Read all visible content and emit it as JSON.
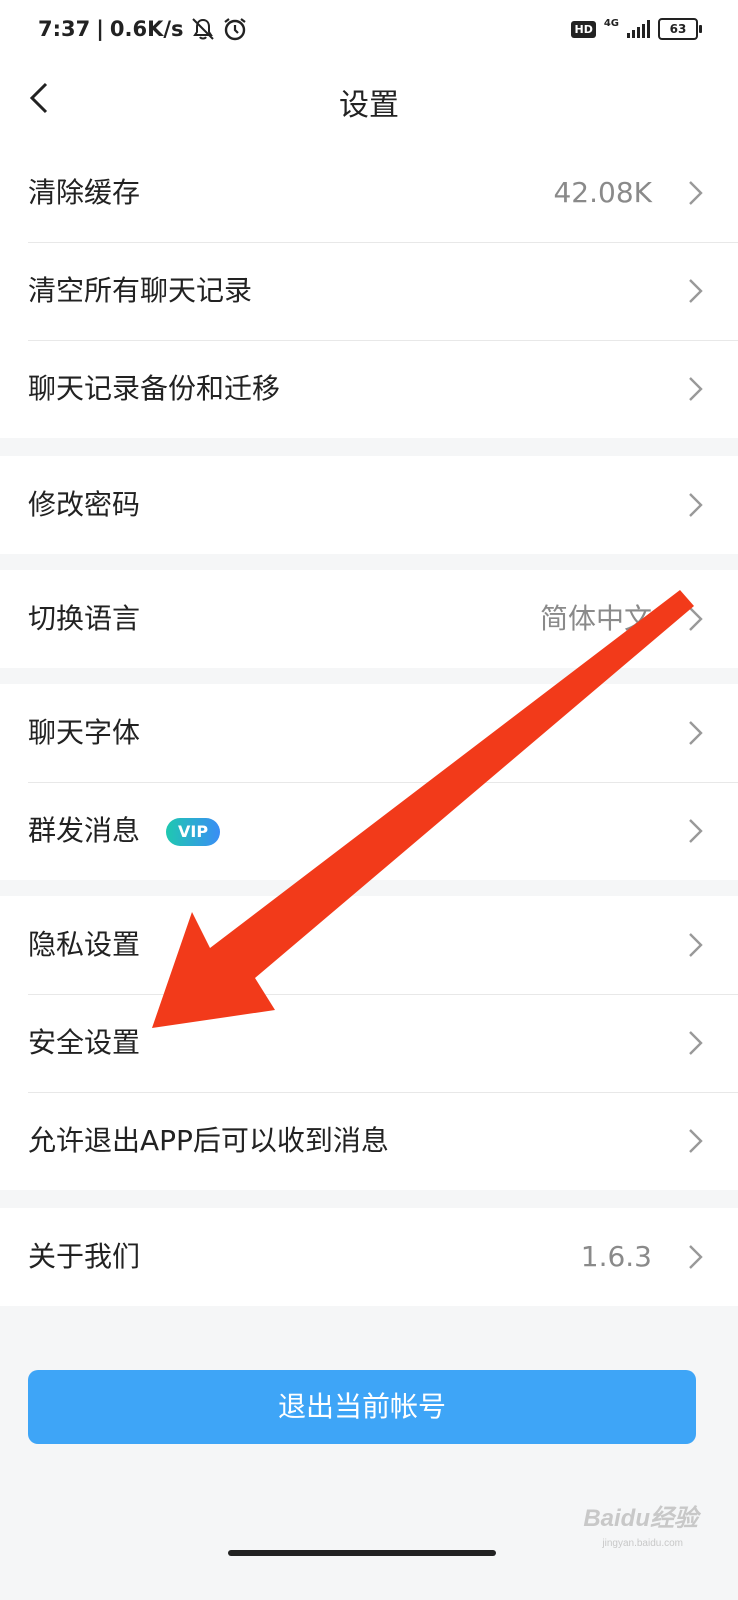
{
  "status_bar": {
    "time": "7:37",
    "divider": "|",
    "net_speed": "0.6K/s",
    "hd": "HD",
    "network": "4G",
    "battery": "63"
  },
  "navbar": {
    "title": "设置"
  },
  "groups": {
    "storage": {
      "clear_cache": {
        "label": "清除缓存",
        "value": "42.08K"
      },
      "clear_chats": {
        "label": "清空所有聊天记录"
      },
      "backup": {
        "label": "聊天记录备份和迁移"
      }
    },
    "account": {
      "change_password": {
        "label": "修改密码"
      }
    },
    "language": {
      "switch_language": {
        "label": "切换语言",
        "value": "简体中文"
      }
    },
    "chat": {
      "chat_font": {
        "label": "聊天字体"
      },
      "broadcast": {
        "label": "群发消息",
        "badge": "VIP"
      }
    },
    "privacy": {
      "privacy_settings": {
        "label": "隐私设置"
      },
      "security_settings": {
        "label": "安全设置"
      },
      "background_messages": {
        "label": "允许退出APP后可以收到消息"
      }
    },
    "about": {
      "about_us": {
        "label": "关于我们",
        "value": "1.6.3"
      }
    }
  },
  "logout_button": "退出当前帐号",
  "annotation": {
    "arrow_color": "#f23a1a"
  },
  "watermark": {
    "text": "Baidu经验",
    "sub": "jingyan.baidu.com"
  },
  "colors": {
    "accent": "#3ea5f7",
    "background": "#f5f6f7",
    "vip_gradient_start": "#1fc8b0",
    "vip_gradient_end": "#3a8df5"
  }
}
